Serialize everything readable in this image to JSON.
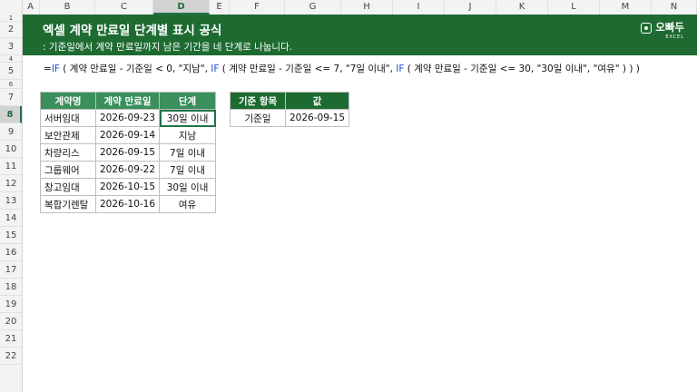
{
  "columns": [
    "A",
    "B",
    "C",
    "D",
    "E",
    "F",
    "G",
    "H",
    "I",
    "J",
    "K",
    "L",
    "M",
    "N"
  ],
  "rows": [
    "1",
    "2",
    "3",
    "4",
    "5",
    "6",
    "7",
    "8",
    "9",
    "10",
    "11",
    "12",
    "13",
    "14",
    "15",
    "16",
    "17",
    "18",
    "19",
    "20",
    "21",
    "22"
  ],
  "banner": {
    "title": "엑셀 계약 만료일 단계별 표시 공식",
    "subtitle": ": 기준일에서 계약 만료일까지 남은 기간을 네 단계로 나눕니다.",
    "logo_text": "오빠두",
    "logo_sub": "EXCEL"
  },
  "formula": {
    "parts": [
      {
        "text": "=",
        "type": "plain"
      },
      {
        "text": "IF",
        "type": "fn"
      },
      {
        "text": " ( 계약 만료일 - 기준일 < 0, \"지남\", ",
        "type": "plain"
      },
      {
        "text": "IF",
        "type": "fn"
      },
      {
        "text": " ( 계약 만료일 - 기준일 <= 7, \"7일 이내\", ",
        "type": "plain"
      },
      {
        "text": "IF",
        "type": "fn"
      },
      {
        "text": " ( 계약 만료일 - 기준일 <= 30, \"30일 이내\", \"여유\" ) ) )",
        "type": "plain"
      }
    ]
  },
  "contract_table": {
    "headers": [
      "계약명",
      "계약 만료일",
      "단계"
    ],
    "rows": [
      [
        "서버임대",
        "2026-09-23",
        "30일 이내"
      ],
      [
        "보안관제",
        "2026-09-14",
        "지남"
      ],
      [
        "차량리스",
        "2026-09-15",
        "7일 이내"
      ],
      [
        "그룹웨어",
        "2026-09-22",
        "7일 이내"
      ],
      [
        "창고임대",
        "2026-10-15",
        "30일 이내"
      ],
      [
        "복합기렌탈",
        "2026-10-16",
        "여유"
      ]
    ]
  },
  "criteria_table": {
    "headers": [
      "기준 항목",
      "값"
    ],
    "rows": [
      [
        "기준일",
        "2026-09-15"
      ]
    ]
  },
  "colors": {
    "banner": "#1e6b32",
    "header_fill": "#3a8f5c",
    "function": "#1f4fd6"
  }
}
